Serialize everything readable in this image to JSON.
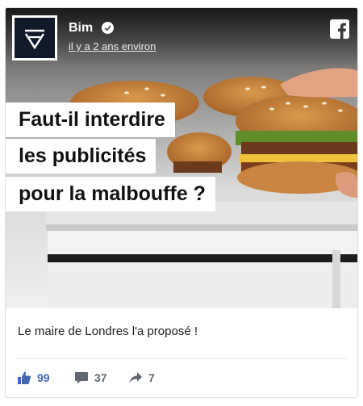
{
  "post": {
    "page_name": "Bim",
    "timestamp": "il y a 2 ans environ",
    "headline_lines": [
      "Faut-il interdire",
      "les publicités",
      "pour la malbouffe ?"
    ],
    "caption": "Le maire de Londres l'a proposé !"
  },
  "actions": {
    "likes": "99",
    "comments": "37",
    "shares": "7"
  },
  "icons": {
    "avatar": "bim-logo-icon",
    "verified": "verified-check-icon",
    "platform": "facebook-icon",
    "like": "thumbs-up-icon",
    "comment": "comment-bubble-icon",
    "share": "share-arrow-icon"
  },
  "colors": {
    "like_blue": "#4267b2",
    "action_gray": "#606770",
    "avatar_bg": "#101a2a"
  }
}
